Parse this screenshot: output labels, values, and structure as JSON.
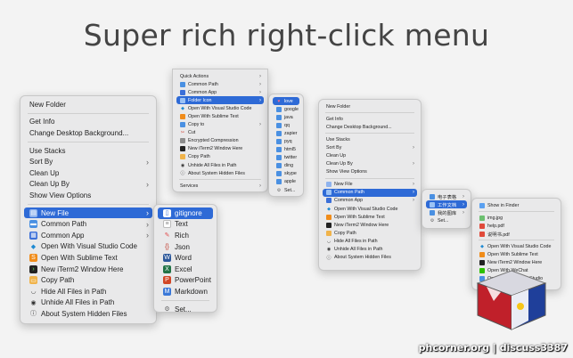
{
  "headline": "Super rich right-click menu",
  "footer": "phcorner.org | discuss3387",
  "menu_big": {
    "groups": [
      [
        "New Folder"
      ],
      [
        "Get Info",
        "Change Desktop Background..."
      ],
      [
        "Use Stacks",
        "Sort By",
        "Clean Up",
        "Clean Up By",
        "Show View Options"
      ],
      [
        "New File",
        "Common Path",
        "Common App",
        "Open With Visual Studio Code",
        "Open With Sublime Text",
        "New iTerm2 Window Here",
        "Copy Path",
        "Hide All Files in Path",
        "Unhide All Files in Path",
        "About System Hidden Files"
      ]
    ]
  },
  "submenu_newfile": [
    "gitignore",
    "Text",
    "Rich",
    "Json",
    "Word",
    "Excel",
    "PowerPoint",
    "Markdown",
    "Set..."
  ],
  "menu_top": {
    "items": [
      "Quick Actions",
      "Common Path",
      "Common App",
      "Folder Icon",
      "Open With Visual Studio Code",
      "Open With Sublime Text",
      "Copy to",
      "Cut",
      "Encrypted Compression",
      "New iTerm2 Window Here",
      "Copy Path",
      "Unhide All Files in Path",
      "About System Hidden Files"
    ],
    "services": "Services"
  },
  "submenu_icons": [
    "love",
    "google",
    "java",
    "qq",
    "zapier",
    "pyq",
    "html5",
    "twitter",
    "ding",
    "skype",
    "apple",
    "Set..."
  ],
  "menu_right": {
    "groups": [
      [
        "New Folder"
      ],
      [
        "Get Info",
        "Change Desktop Background..."
      ],
      [
        "Use Stacks",
        "Sort By",
        "Clean Up",
        "Clean Up By",
        "Show View Options"
      ],
      [
        "New File",
        "Common Path",
        "Common App",
        "Open With Visual Studio Code",
        "Open With Sublime Text",
        "New iTerm2 Window Here",
        "Copy Path",
        "Hide All Files in Path",
        "Unhide All Files in Path",
        "About System Hidden Files"
      ]
    ]
  },
  "submenu_common_path": [
    "电子表格",
    "工作文档",
    "我的图库",
    "Set..."
  ],
  "submenu_work_docs": [
    "Show in Finder",
    "img.jpg",
    "help.pdf",
    "说明书.pdf",
    "Open With Visual Studio Code",
    "Open With Sublime Text",
    "New iTerm2 Window Here",
    "Open With WeChat",
    "Open With Sublime Studio"
  ],
  "colors": {
    "accent": "#2e6ad6",
    "menu_bg": "#e9e9ea",
    "background": "#f3f3f3"
  }
}
